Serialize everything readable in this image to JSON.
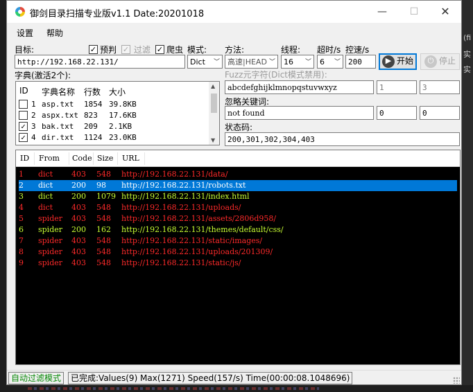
{
  "window": {
    "title": "御剑目录扫描专业版v1.1 Date:20201018",
    "min_glyph": "—",
    "max_glyph": "☐",
    "close_glyph": "✕"
  },
  "menu": {
    "settings": "设置",
    "help": "帮助"
  },
  "target": {
    "label": "目标:",
    "value": "http://192.168.22.131/",
    "predict_label": "预判",
    "filter_label": "过滤",
    "crawl_label": "爬虫",
    "predict_checked": true,
    "filter_checked": true,
    "crawl_checked": true
  },
  "mode": {
    "label": "模式:",
    "value": "Dict"
  },
  "method": {
    "label": "方法:",
    "value": "高速|HEAD"
  },
  "threads": {
    "label": "线程:",
    "value": "16"
  },
  "timeout": {
    "label": "超时/s",
    "value": "6"
  },
  "speed": {
    "label": "控速/s",
    "value": "200"
  },
  "buttons": {
    "start": "开始",
    "stop": "停止"
  },
  "dict": {
    "label": "字典(激活2个):",
    "headers": {
      "id": "ID",
      "name": "字典名称",
      "lines": "行数",
      "size": "大小"
    },
    "rows": [
      {
        "id": "1",
        "name": "asp.txt",
        "lines": "1854",
        "size": "39.8KB",
        "checked": false
      },
      {
        "id": "2",
        "name": "aspx.txt",
        "lines": "823",
        "size": "17.6KB",
        "checked": false
      },
      {
        "id": "3",
        "name": "bak.txt",
        "lines": "209",
        "size": "2.1KB",
        "checked": true
      },
      {
        "id": "4",
        "name": "dir.txt",
        "lines": "1124",
        "size": "23.0KB",
        "checked": true
      }
    ]
  },
  "fuzz": {
    "label": "Fuzz元字符(Dict模式禁用):",
    "chars": "abcdefghijklmnopqstuvwxyz",
    "min": "1",
    "max": "3"
  },
  "ignore": {
    "label": "忽略关键词:",
    "value": "not found",
    "a": "0",
    "b": "0"
  },
  "status_codes": {
    "label": "状态码:",
    "value": "200,301,302,304,403"
  },
  "results": {
    "headers": {
      "id": "ID",
      "from": "From",
      "code": "Code",
      "size": "Size",
      "url": "URL"
    },
    "rows": [
      {
        "id": "1",
        "from": "dict",
        "code": "403",
        "size": "548",
        "url": "http://192.168.22.131/data/",
        "color": "#ff2a2a"
      },
      {
        "id": "2",
        "from": "dict",
        "code": "200",
        "size": "98",
        "url": "http://192.168.22.131/robots.txt",
        "color": "#ffffff",
        "selected": true
      },
      {
        "id": "3",
        "from": "dict",
        "code": "200",
        "size": "1079",
        "url": "http://192.168.22.131/index.html",
        "color": "#c8ff32"
      },
      {
        "id": "4",
        "from": "dict",
        "code": "403",
        "size": "548",
        "url": "http://192.168.22.131/uploads/",
        "color": "#ff2a2a"
      },
      {
        "id": "5",
        "from": "spider",
        "code": "403",
        "size": "548",
        "url": "http://192.168.22.131/assets/2806d958/",
        "color": "#ff2a2a"
      },
      {
        "id": "6",
        "from": "spider",
        "code": "200",
        "size": "162",
        "url": "http://192.168.22.131/themes/default/css/",
        "color": "#c8ff32"
      },
      {
        "id": "7",
        "from": "spider",
        "code": "403",
        "size": "548",
        "url": "http://192.168.22.131/static/images/",
        "color": "#ff2a2a"
      },
      {
        "id": "8",
        "from": "spider",
        "code": "403",
        "size": "548",
        "url": "http://192.168.22.131/uploads/201309/",
        "color": "#ff2a2a"
      },
      {
        "id": "9",
        "from": "spider",
        "code": "403",
        "size": "548",
        "url": "http://192.168.22.131/static/js/",
        "color": "#ff2a2a"
      }
    ]
  },
  "statusbar": {
    "mode": "自动过滤模式",
    "summary": "已完成:Values(9) Max(1271) Speed(157/s) Time(00:00:08.1048696)"
  },
  "background": {
    "side_chars": [
      "(fi",
      "实",
      "实"
    ]
  }
}
